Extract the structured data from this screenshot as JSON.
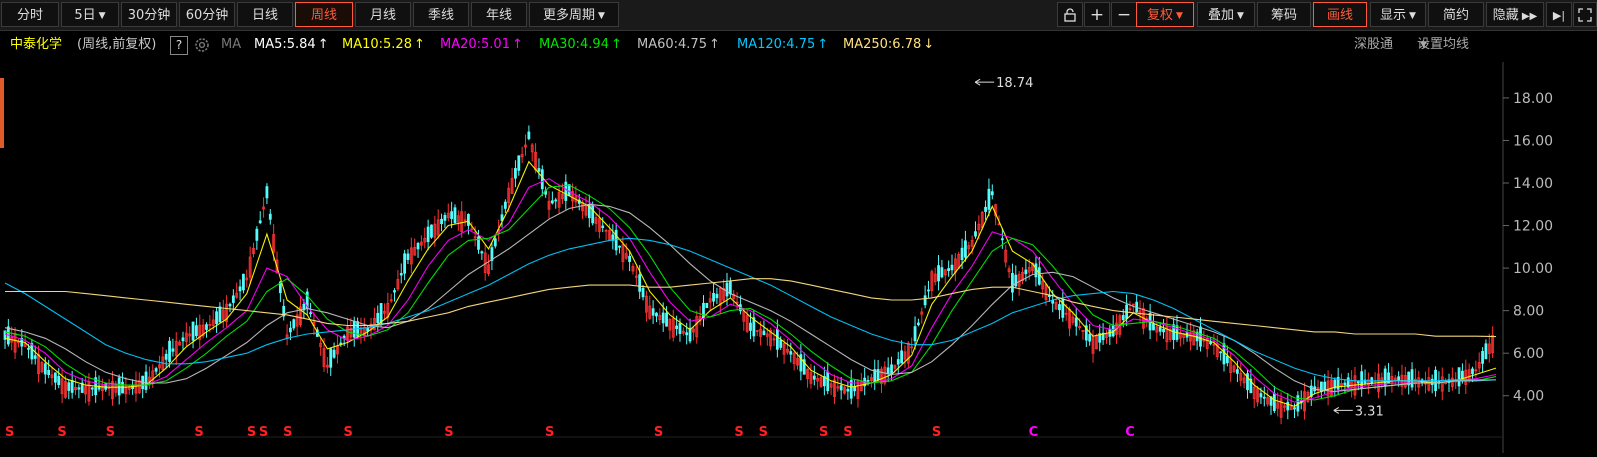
{
  "toolbar": {
    "period_tabs": [
      {
        "label": "分时",
        "active": false
      },
      {
        "label": "5日",
        "active": false,
        "has_dropdown": true
      },
      {
        "label": "30分钟",
        "active": false
      },
      {
        "label": "60分钟",
        "active": false
      },
      {
        "label": "日线",
        "active": false
      },
      {
        "label": "周线",
        "active": true
      },
      {
        "label": "月线",
        "active": false
      },
      {
        "label": "季线",
        "active": false
      },
      {
        "label": "年线",
        "active": false
      },
      {
        "label": "更多周期",
        "active": false,
        "has_dropdown": true
      }
    ],
    "right_buttons": {
      "lock_icon": "unlock-icon",
      "zoom_in": "+",
      "zoom_out": "−",
      "fuquan": "复权",
      "overlay": "叠加",
      "chips": "筹码",
      "draw": "画线",
      "display": "显示",
      "simple": "简约",
      "hide": "隐藏"
    }
  },
  "info": {
    "stock_name": "中泰化学",
    "subtitle": "(周线,前复权)",
    "help": "?",
    "ma_label": "MA",
    "ma_values": [
      {
        "text": "MA5:5.84",
        "arrow": "↑",
        "color": "#ffffff"
      },
      {
        "text": "MA10:5.28",
        "arrow": "↑",
        "color": "#ffff00"
      },
      {
        "text": "MA20:5.01",
        "arrow": "↑",
        "color": "#ff00ff"
      },
      {
        "text": "MA30:4.94",
        "arrow": "↑",
        "color": "#00e600"
      },
      {
        "text": "MA60:4.75",
        "arrow": "↑",
        "color": "#c0c0c0"
      },
      {
        "text": "MA120:4.75",
        "arrow": "↑",
        "color": "#00c8ff"
      },
      {
        "text": "MA250:6.78",
        "arrow": "↓",
        "color": "#ffe080"
      }
    ],
    "shengutong": "深股通",
    "ma_settings": "设置均线"
  },
  "chart_data": {
    "type": "line",
    "title": "",
    "xlabel": "",
    "ylabel": "",
    "ylim": [
      3.0,
      19.5
    ],
    "y_ticks": [
      "18.00",
      "16.00",
      "14.00",
      "12.00",
      "10.00",
      "8.00",
      "6.00",
      "4.00"
    ],
    "annotations": [
      {
        "text": "18.74",
        "x": 240,
        "y": 18.74
      },
      {
        "text": "3.31",
        "x": 329,
        "y": 3.31
      }
    ],
    "x": [
      0,
      5,
      10,
      15,
      20,
      25,
      30,
      35,
      40,
      45,
      50,
      55,
      60,
      65,
      70,
      75,
      80,
      85,
      90,
      95,
      100,
      105,
      110,
      115,
      120,
      125,
      130,
      135,
      140,
      145,
      150,
      155,
      160,
      165,
      170,
      175,
      180,
      185,
      190,
      195,
      200,
      205,
      210,
      215,
      220,
      225,
      230,
      235,
      240,
      245,
      250,
      255,
      260,
      265,
      270,
      275,
      280,
      285,
      290,
      295,
      300,
      305,
      310,
      315,
      320,
      325,
      330,
      335,
      340,
      345,
      350,
      355,
      360,
      365,
      370
    ],
    "series": [
      {
        "name": "Close",
        "color": "#ffffff",
        "values": [
          6.8,
          6.4,
          5.2,
          4.4,
          4.3,
          4.4,
          4.3,
          4.6,
          5.8,
          6.8,
          7.2,
          8.0,
          9.5,
          13.5,
          6.8,
          8.4,
          5.4,
          7.0,
          7.1,
          8.1,
          10.5,
          11.5,
          12.5,
          12.2,
          10.0,
          13.5,
          16.2,
          13.0,
          13.6,
          12.6,
          11.6,
          10.4,
          8.0,
          7.4,
          6.8,
          8.5,
          9.0,
          7.2,
          6.8,
          6.0,
          4.9,
          4.5,
          4.2,
          4.8,
          5.2,
          6.3,
          9.5,
          10.0,
          11.2,
          13.5,
          9.2,
          10.1,
          8.4,
          7.6,
          6.5,
          7.0,
          8.3,
          7.2,
          6.9,
          6.8,
          6.4,
          5.3,
          4.2,
          3.6,
          3.4,
          4.3,
          4.5,
          4.6,
          4.7,
          4.8,
          4.7,
          4.6,
          4.7,
          5.2,
          6.8
        ]
      },
      {
        "name": "MA10",
        "color": "#ffff00",
        "values": [
          6.7,
          6.5,
          5.6,
          4.8,
          4.5,
          4.4,
          4.4,
          4.5,
          5.3,
          6.3,
          7.0,
          7.6,
          8.8,
          11.6,
          8.5,
          7.8,
          6.2,
          6.5,
          7.0,
          7.7,
          9.4,
          10.9,
          12.0,
          12.2,
          10.9,
          12.8,
          15.0,
          13.9,
          13.4,
          12.9,
          11.9,
          10.8,
          8.9,
          7.8,
          7.1,
          8.0,
          8.6,
          7.7,
          7.0,
          6.3,
          5.2,
          4.7,
          4.4,
          4.6,
          5.0,
          5.9,
          8.3,
          9.6,
          10.8,
          12.9,
          10.8,
          10.2,
          8.8,
          7.9,
          6.8,
          7.0,
          7.9,
          7.4,
          7.0,
          6.8,
          6.5,
          5.6,
          4.5,
          3.8,
          3.5,
          4.1,
          4.4,
          4.5,
          4.6,
          4.7,
          4.7,
          4.6,
          4.7,
          5.0,
          5.3
        ]
      },
      {
        "name": "MA20",
        "color": "#ff00ff",
        "values": [
          6.9,
          6.6,
          6.0,
          5.1,
          4.7,
          4.5,
          4.5,
          4.5,
          4.9,
          5.7,
          6.5,
          7.2,
          8.0,
          10.0,
          9.6,
          8.2,
          7.1,
          6.6,
          6.8,
          7.3,
          8.5,
          10.1,
          11.3,
          11.8,
          11.3,
          12.1,
          13.8,
          14.2,
          13.6,
          13.1,
          12.4,
          11.4,
          9.8,
          8.4,
          7.5,
          7.7,
          8.3,
          8.0,
          7.4,
          6.6,
          5.7,
          5.0,
          4.6,
          4.6,
          4.8,
          5.4,
          7.2,
          8.8,
          10.1,
          11.7,
          11.4,
          10.8,
          9.5,
          8.3,
          7.3,
          7.1,
          7.6,
          7.5,
          7.2,
          6.9,
          6.6,
          5.9,
          4.9,
          4.1,
          3.7,
          3.9,
          4.2,
          4.4,
          4.5,
          4.6,
          4.6,
          4.6,
          4.7,
          4.8,
          5.0
        ]
      },
      {
        "name": "MA30",
        "color": "#00e600",
        "values": [
          7.0,
          6.8,
          6.3,
          5.5,
          4.9,
          4.6,
          4.5,
          4.5,
          4.7,
          5.3,
          6.0,
          6.8,
          7.5,
          8.9,
          9.5,
          8.7,
          7.6,
          7.0,
          6.8,
          7.1,
          7.9,
          9.3,
          10.6,
          11.3,
          11.4,
          11.8,
          12.8,
          13.8,
          13.9,
          13.4,
          12.8,
          11.9,
          10.6,
          9.1,
          8.0,
          7.7,
          8.0,
          8.1,
          7.6,
          6.9,
          6.1,
          5.4,
          4.8,
          4.6,
          4.7,
          5.1,
          6.4,
          8.0,
          9.4,
          10.8,
          11.4,
          11.1,
          10.1,
          8.9,
          7.8,
          7.3,
          7.4,
          7.5,
          7.3,
          7.0,
          6.7,
          6.1,
          5.3,
          4.4,
          3.9,
          3.8,
          4.0,
          4.3,
          4.4,
          4.5,
          4.6,
          4.6,
          4.7,
          4.7,
          4.9
        ]
      },
      {
        "name": "MA60",
        "color": "#c0c0c0",
        "values": [
          7.2,
          7.0,
          6.7,
          6.2,
          5.6,
          5.1,
          4.8,
          4.6,
          4.6,
          4.8,
          5.3,
          5.9,
          6.5,
          7.3,
          7.9,
          8.1,
          7.9,
          7.6,
          7.3,
          7.2,
          7.5,
          8.1,
          8.9,
          9.7,
          10.3,
          10.9,
          11.6,
          12.3,
          12.8,
          13.0,
          12.9,
          12.6,
          11.9,
          11.1,
          10.2,
          9.4,
          8.8,
          8.4,
          8.0,
          7.5,
          6.9,
          6.3,
          5.7,
          5.2,
          5.0,
          5.1,
          5.6,
          6.4,
          7.3,
          8.3,
          9.2,
          9.7,
          9.8,
          9.6,
          9.1,
          8.6,
          8.2,
          7.9,
          7.6,
          7.3,
          7.0,
          6.6,
          6.0,
          5.3,
          4.7,
          4.3,
          4.2,
          4.3,
          4.4,
          4.5,
          4.6,
          4.6,
          4.7,
          4.7,
          4.75
        ]
      },
      {
        "name": "MA120",
        "color": "#00c8ff",
        "values": [
          9.3,
          8.8,
          8.2,
          7.6,
          7.0,
          6.4,
          6.0,
          5.7,
          5.5,
          5.5,
          5.6,
          5.8,
          6.0,
          6.4,
          6.7,
          6.9,
          7.0,
          7.1,
          7.2,
          7.4,
          7.7,
          8.0,
          8.4,
          8.8,
          9.2,
          9.7,
          10.2,
          10.6,
          10.9,
          11.1,
          11.3,
          11.4,
          11.3,
          11.1,
          10.8,
          10.4,
          10.0,
          9.6,
          9.2,
          8.7,
          8.2,
          7.7,
          7.3,
          6.9,
          6.6,
          6.4,
          6.4,
          6.6,
          7.0,
          7.4,
          7.9,
          8.2,
          8.5,
          8.7,
          8.8,
          8.9,
          8.8,
          8.5,
          8.1,
          7.6,
          7.1,
          6.6,
          6.1,
          5.7,
          5.3,
          5.0,
          4.8,
          4.7,
          4.7,
          4.7,
          4.7,
          4.7,
          4.75,
          4.75,
          4.75
        ]
      },
      {
        "name": "MA250",
        "color": "#ffe080",
        "values": [
          8.9,
          8.9,
          8.9,
          8.9,
          8.8,
          8.7,
          8.6,
          8.5,
          8.4,
          8.3,
          8.2,
          8.1,
          8.0,
          7.9,
          7.8,
          7.6,
          7.4,
          7.3,
          7.3,
          7.4,
          7.5,
          7.7,
          7.9,
          8.2,
          8.4,
          8.6,
          8.8,
          9.0,
          9.1,
          9.2,
          9.2,
          9.2,
          9.1,
          9.1,
          9.2,
          9.3,
          9.4,
          9.5,
          9.5,
          9.4,
          9.2,
          9.0,
          8.8,
          8.6,
          8.5,
          8.5,
          8.6,
          8.8,
          9.0,
          9.1,
          9.1,
          8.9,
          8.7,
          8.4,
          8.2,
          8.0,
          7.9,
          7.8,
          7.7,
          7.6,
          7.5,
          7.4,
          7.3,
          7.2,
          7.1,
          7.0,
          7.0,
          6.9,
          6.9,
          6.9,
          6.9,
          6.8,
          6.8,
          6.8,
          6.78
        ]
      }
    ],
    "markers": [
      {
        "symbol": "S",
        "x": 1,
        "color": "#ff2020"
      },
      {
        "symbol": "S",
        "x": 14,
        "color": "#ff2020"
      },
      {
        "symbol": "S",
        "x": 26,
        "color": "#ff2020"
      },
      {
        "symbol": "S",
        "x": 48,
        "color": "#ff2020"
      },
      {
        "symbol": "S",
        "x": 61,
        "color": "#ff2020"
      },
      {
        "symbol": "S",
        "x": 64,
        "color": "#ff2020"
      },
      {
        "symbol": "S",
        "x": 70,
        "color": "#ff2020"
      },
      {
        "symbol": "S",
        "x": 85,
        "color": "#ff2020"
      },
      {
        "symbol": "S",
        "x": 110,
        "color": "#ff2020"
      },
      {
        "symbol": "S",
        "x": 135,
        "color": "#ff2020"
      },
      {
        "symbol": "S",
        "x": 162,
        "color": "#ff2020"
      },
      {
        "symbol": "S",
        "x": 182,
        "color": "#ff2020"
      },
      {
        "symbol": "S",
        "x": 188,
        "color": "#ff2020"
      },
      {
        "symbol": "S",
        "x": 203,
        "color": "#ff2020"
      },
      {
        "symbol": "S",
        "x": 209,
        "color": "#ff2020"
      },
      {
        "symbol": "S",
        "x": 231,
        "color": "#ff2020"
      },
      {
        "symbol": "C",
        "x": 255,
        "color": "#ff00ff"
      },
      {
        "symbol": "C",
        "x": 279,
        "color": "#ff00ff"
      }
    ]
  }
}
